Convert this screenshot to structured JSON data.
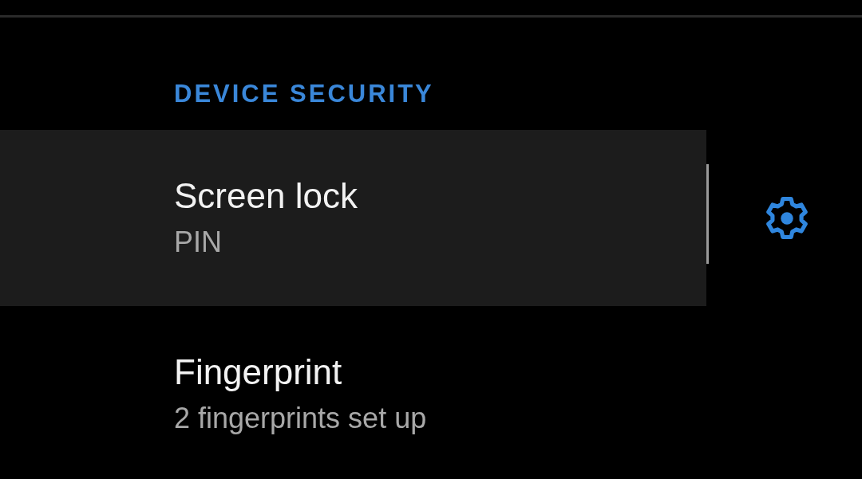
{
  "section": {
    "title": "DEVICE SECURITY"
  },
  "items": [
    {
      "title": "Screen lock",
      "summary": "PIN",
      "selected": true,
      "has_settings": true
    },
    {
      "title": "Fingerprint",
      "summary": "2 fingerprints set up",
      "selected": false,
      "has_settings": false
    }
  ]
}
